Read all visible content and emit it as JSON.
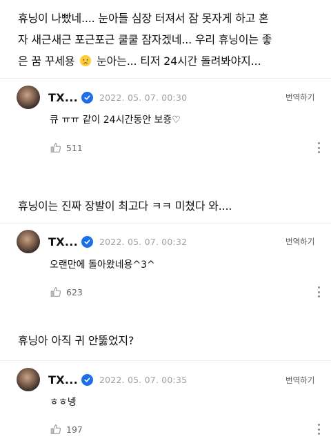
{
  "threads": [
    {
      "comment_lines": [
        "휴닝이 나빴네.... 눈아들 심장 터져서 잠 못자게 하고 혼",
        "자 새근새근 포근포근 쿨쿨 잠자겠네... 우리 휴닝이는 좋",
        "은 꿈 꾸세용",
        "눈아는... 티저 24시간 돌려봐야지..."
      ],
      "reply": {
        "name": "TX...",
        "date": "2022. 05. 07. 00:30",
        "translate": "번역하기",
        "text": "큐 ㅠㅠ 같이 24시간동안 보죵♡",
        "likes": "511"
      }
    },
    {
      "comment_lines": [
        "휴닝이는 진짜 장발이 최고다 ㅋㅋ 미쳤다 와...."
      ],
      "reply": {
        "name": "TX...",
        "date": "2022. 05. 07. 00:32",
        "translate": "번역하기",
        "text": "오랜만에 돌아왔네용^3^",
        "likes": "623"
      }
    },
    {
      "comment_lines": [
        "휴닝아 아직 귀 안뚫었지?"
      ],
      "reply": {
        "name": "TX...",
        "date": "2022. 05. 07. 00:35",
        "translate": "번역하기",
        "text": "ㅎㅎ넹",
        "likes": "197"
      }
    }
  ],
  "icons": {
    "verified": "verified-badge-icon",
    "like": "thumbs-up-icon",
    "more": "more-vertical-icon",
    "emoji": "crying-face-emoji"
  },
  "colors": {
    "verified": "#1d6fe8",
    "date": "#a0a0a0",
    "text": "#111111"
  }
}
